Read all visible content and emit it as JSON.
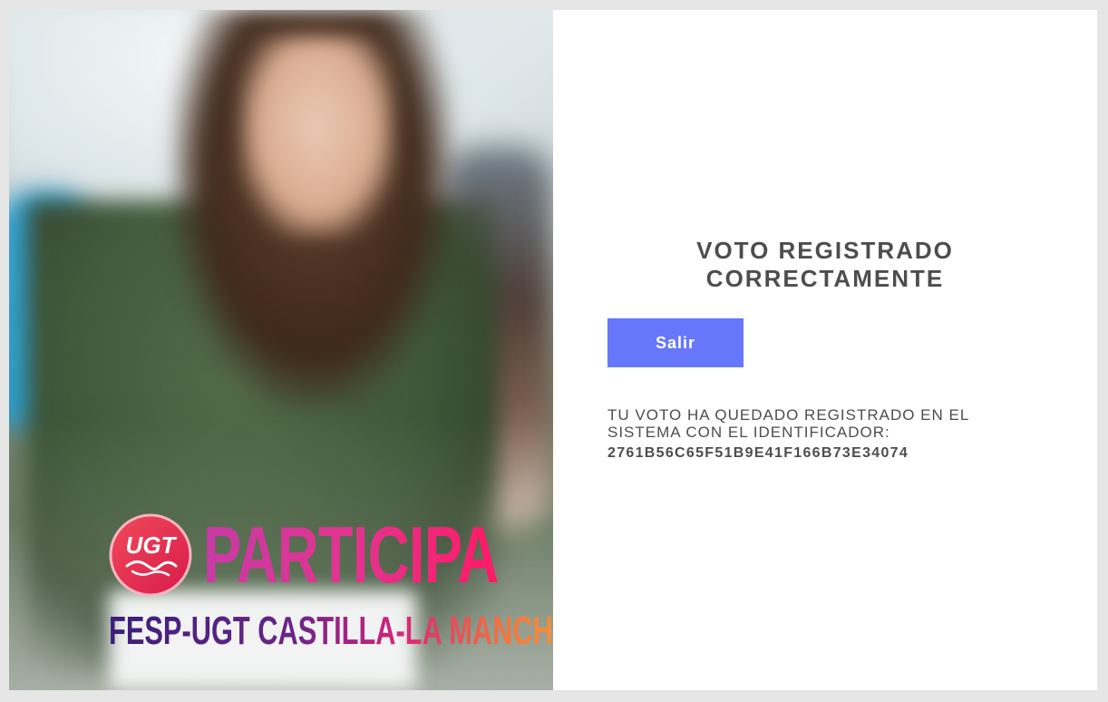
{
  "hero": {
    "logo_text": "UGT",
    "headline": "PARTICIPA",
    "region": "FESP-UGT CASTILLA-LA MANCHA"
  },
  "result": {
    "title_line1": "VOTO REGISTRADO",
    "title_line2": "CORRECTAMENTE",
    "exit_label": "Salir",
    "message": "TU VOTO HA QUEDADO REGISTRADO EN EL SISTEMA CON EL IDENTIFICADOR:",
    "identifier": "2761B56C65F51B9E41F166B73E34074"
  },
  "colors": {
    "button": "#6677fb",
    "text": "#4d4d4d",
    "brand_pink": "#e0358f",
    "brand_purple": "#3a1f7a",
    "brand_orange": "#f79a3a"
  }
}
